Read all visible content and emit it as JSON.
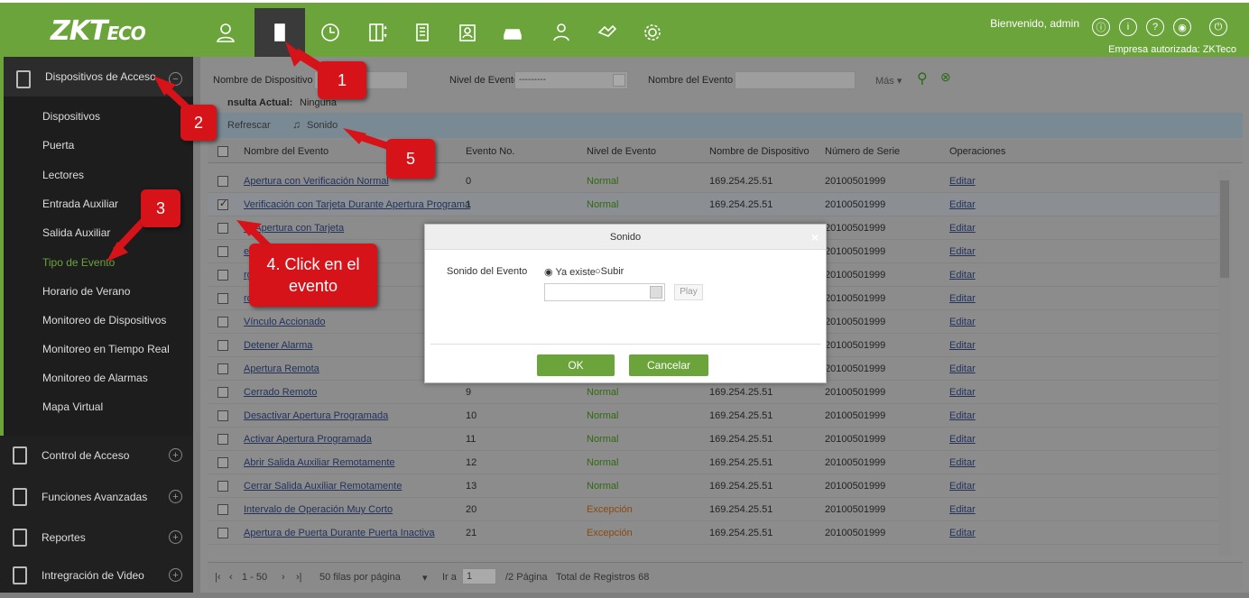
{
  "brand": "ZKTeco",
  "header": {
    "welcome": "Bienvenido, admin",
    "company": "Empresa autorizada: ZKTeco"
  },
  "nav_icons": [
    "user-icon",
    "door-icon",
    "clock-icon",
    "elevator-icon",
    "building-icon",
    "visitor-icon",
    "car-icon",
    "patrol-icon",
    "handshake-icon",
    "gear-icon"
  ],
  "header_icons": [
    "help-person-icon",
    "info-icon",
    "question-icon",
    "account-icon",
    "power-icon"
  ],
  "sidebar": {
    "section": "Dispositivos de Acceso",
    "items": [
      "Dispositivos",
      "Puerta",
      "Lectores",
      "Entrada Auxiliar",
      "Salida Auxiliar",
      "Tipo de Evento",
      "Horario de Verano",
      "Monitoreo de Dispositivos",
      "Monitoreo en Tiempo Real",
      "Monitoreo de Alarmas",
      "Mapa Virtual"
    ],
    "selected": "Tipo de Evento",
    "groups": [
      "Control de Acceso",
      "Funciones Avanzadas",
      "Reportes",
      "Intregración de Video"
    ]
  },
  "filter": {
    "device_label": "Nombre de Dispositivo",
    "level_label": "Nivel de Evento",
    "level_value": "---------",
    "event_label": "Nombre del Evento",
    "more": "Más",
    "consulta_label": "nsulta Actual:",
    "consulta_value": "Ninguna"
  },
  "toolbar": {
    "refresh": "Refrescar",
    "sound": "Sonido"
  },
  "columns": [
    "Nombre del Evento",
    "Evento No.",
    "Nivel de Evento",
    "Nombre de Dispositivo",
    "Número de Serie",
    "Operaciones"
  ],
  "rows": [
    {
      "name": "Apertura con Verificación Normal",
      "no": "0",
      "level": "Normal",
      "device": "169.254.25.51",
      "serial": "20100501999",
      "op": "Editar"
    },
    {
      "name": "Verificación con Tarjeta Durante Apertura Programa",
      "no": "1",
      "level": "Normal",
      "device": "169.254.25.51",
      "serial": "20100501999",
      "op": "Editar"
    },
    {
      "name": "ra Apertura con Tarjeta",
      "no": "",
      "level": "",
      "device": "",
      "serial": "20100501999",
      "op": "Editar"
    },
    {
      "name": "eta",
      "no": "",
      "level": "",
      "device": "",
      "serial": "20100501999",
      "op": "Editar"
    },
    {
      "name": "rgencia",
      "no": "",
      "level": "",
      "device": "",
      "serial": "20100501999",
      "op": "Editar"
    },
    {
      "name": "rograma",
      "no": "",
      "level": "",
      "device": "",
      "serial": "20100501999",
      "op": "Editar"
    },
    {
      "name": "Vínculo Accionado",
      "no": "",
      "level": "",
      "device": "",
      "serial": "20100501999",
      "op": "Editar"
    },
    {
      "name": "Detener Alarma",
      "no": "",
      "level": "",
      "device": "",
      "serial": "20100501999",
      "op": "Editar"
    },
    {
      "name": "Apertura Remota",
      "no": "",
      "level": "",
      "device": "",
      "serial": "20100501999",
      "op": "Editar"
    },
    {
      "name": "Cerrado Remoto",
      "no": "9",
      "level": "Normal",
      "device": "169.254.25.51",
      "serial": "20100501999",
      "op": "Editar"
    },
    {
      "name": "Desactivar Apertura Programada",
      "no": "10",
      "level": "Normal",
      "device": "169.254.25.51",
      "serial": "20100501999",
      "op": "Editar"
    },
    {
      "name": "Activar Apertura Programada",
      "no": "11",
      "level": "Normal",
      "device": "169.254.25.51",
      "serial": "20100501999",
      "op": "Editar"
    },
    {
      "name": "Abrir Salida Auxiliar Remotamente",
      "no": "12",
      "level": "Normal",
      "device": "169.254.25.51",
      "serial": "20100501999",
      "op": "Editar"
    },
    {
      "name": "Cerrar Salida Auxiliar Remotamente",
      "no": "13",
      "level": "Normal",
      "device": "169.254.25.51",
      "serial": "20100501999",
      "op": "Editar"
    },
    {
      "name": "Intervalo de Operación Muy Corto",
      "no": "20",
      "level": "Excepción",
      "device": "169.254.25.51",
      "serial": "20100501999",
      "op": "Editar"
    },
    {
      "name": "Apertura de Puerta Durante Puerta Inactiva",
      "no": "21",
      "level": "Excepción",
      "device": "169.254.25.51",
      "serial": "20100501999",
      "op": "Editar"
    }
  ],
  "pager": {
    "range": "1 - 50",
    "per_page": "50 filas por página",
    "goto": "Ir a",
    "page": "1",
    "pages": "/2 Página",
    "total": "Total de Registros 68"
  },
  "modal": {
    "title": "Sonido",
    "field": "Sonido del Evento",
    "opt_exists": "Ya existe",
    "opt_upload": "Subir",
    "play": "Play",
    "ok": "OK",
    "cancel": "Cancelar"
  },
  "callouts": {
    "c1": "1",
    "c2": "2",
    "c3": "3",
    "c4": "4. Click en el evento",
    "c5": "5"
  },
  "colors": {
    "brand_green": "#6aa43a",
    "callout_red": "#d7131a"
  }
}
